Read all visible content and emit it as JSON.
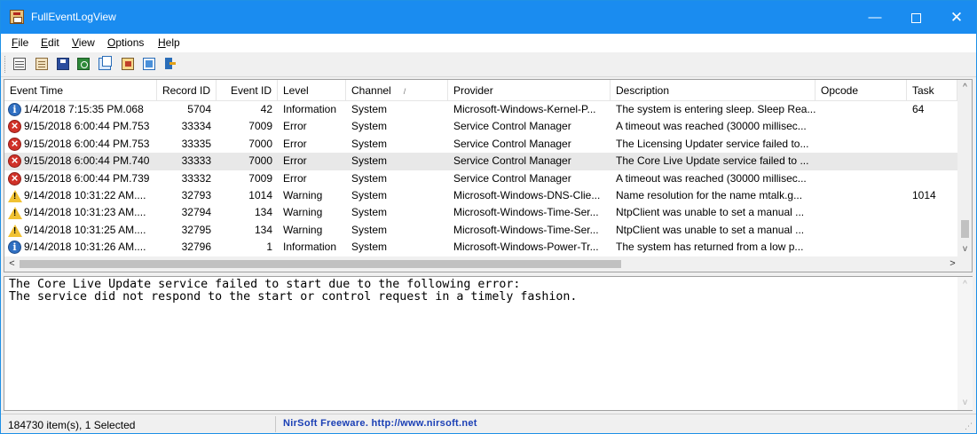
{
  "window": {
    "title": "FullEventLogView",
    "minimize": "—",
    "close": "✕"
  },
  "menu": {
    "items": [
      {
        "label": "File",
        "access": "F",
        "rest": "ile"
      },
      {
        "label": "Edit",
        "access": "E",
        "rest": "dit"
      },
      {
        "label": "View",
        "access": "V",
        "rest": "iew"
      },
      {
        "label": "Options",
        "access": "O",
        "rest": "ptions"
      },
      {
        "label": "Help",
        "access": "H",
        "rest": "elp"
      }
    ]
  },
  "toolbar": {
    "icons": [
      "properties-icon",
      "event-log-icon",
      "save-icon",
      "refresh-icon",
      "copy-icon",
      "report-icon",
      "html-report-icon",
      "exit-icon"
    ]
  },
  "table": {
    "columns": [
      "Event Time",
      "Record ID",
      "Event ID",
      "Level",
      "Channel",
      "Provider",
      "Description",
      "Opcode",
      "Task"
    ],
    "sorted_column": "Channel",
    "sort_arrow": "/",
    "rows": [
      {
        "level_icon": "information-icon",
        "time": "1/4/2018 7:15:35 PM.068",
        "record_id": "5704",
        "event_id": "42",
        "level": "Information",
        "channel": "System",
        "provider": "Microsoft-Windows-Kernel-P...",
        "description": "The system is entering sleep. Sleep Rea...",
        "opcode": "",
        "task": "64",
        "selected": false
      },
      {
        "level_icon": "error-icon",
        "time": "9/15/2018 6:00:44 PM.753",
        "record_id": "33334",
        "event_id": "7009",
        "level": "Error",
        "channel": "System",
        "provider": "Service Control Manager",
        "description": "A timeout was reached (30000 millisec...",
        "opcode": "",
        "task": "",
        "selected": false
      },
      {
        "level_icon": "error-icon",
        "time": "9/15/2018 6:00:44 PM.753",
        "record_id": "33335",
        "event_id": "7000",
        "level": "Error",
        "channel": "System",
        "provider": "Service Control Manager",
        "description": "The Licensing Updater service failed to...",
        "opcode": "",
        "task": "",
        "selected": false
      },
      {
        "level_icon": "error-icon",
        "time": "9/15/2018 6:00:44 PM.740",
        "record_id": "33333",
        "event_id": "7000",
        "level": "Error",
        "channel": "System",
        "provider": "Service Control Manager",
        "description": "The Core Live Update service failed to ...",
        "opcode": "",
        "task": "",
        "selected": true
      },
      {
        "level_icon": "error-icon",
        "time": "9/15/2018 6:00:44 PM.739",
        "record_id": "33332",
        "event_id": "7009",
        "level": "Error",
        "channel": "System",
        "provider": "Service Control Manager",
        "description": "A timeout was reached (30000 millisec...",
        "opcode": "",
        "task": "",
        "selected": false
      },
      {
        "level_icon": "warning-icon",
        "time": "9/14/2018 10:31:22 AM....",
        "record_id": "32793",
        "event_id": "1014",
        "level": "Warning",
        "channel": "System",
        "provider": "Microsoft-Windows-DNS-Clie...",
        "description": "Name resolution for the name mtalk.g...",
        "opcode": "",
        "task": "1014",
        "selected": false
      },
      {
        "level_icon": "warning-icon",
        "time": "9/14/2018 10:31:23 AM....",
        "record_id": "32794",
        "event_id": "134",
        "level": "Warning",
        "channel": "System",
        "provider": "Microsoft-Windows-Time-Ser...",
        "description": "NtpClient was unable to set a manual ...",
        "opcode": "",
        "task": "",
        "selected": false
      },
      {
        "level_icon": "warning-icon",
        "time": "9/14/2018 10:31:25 AM....",
        "record_id": "32795",
        "event_id": "134",
        "level": "Warning",
        "channel": "System",
        "provider": "Microsoft-Windows-Time-Ser...",
        "description": "NtpClient was unable to set a manual ...",
        "opcode": "",
        "task": "",
        "selected": false
      },
      {
        "level_icon": "information-icon",
        "time": "9/14/2018 10:31:26 AM....",
        "record_id": "32796",
        "event_id": "1",
        "level": "Information",
        "channel": "System",
        "provider": "Microsoft-Windows-Power-Tr...",
        "description": "The system has returned from a low p...",
        "opcode": "",
        "task": "",
        "selected": false
      }
    ]
  },
  "scroll": {
    "up": "^",
    "down": "v",
    "left": "<",
    "right": ">"
  },
  "detail": {
    "text": "The Core Live Update service failed to start due to the following error: \nThe service did not respond to the start or control request in a timely fashion."
  },
  "status": {
    "count": "184730 item(s), 1 Selected",
    "link": "NirSoft Freeware.  http://www.nirsoft.net"
  },
  "colors": {
    "titlebar": "#1a8cf0",
    "selected_row": "#e8e8e8",
    "link": "#1a3fb5"
  }
}
